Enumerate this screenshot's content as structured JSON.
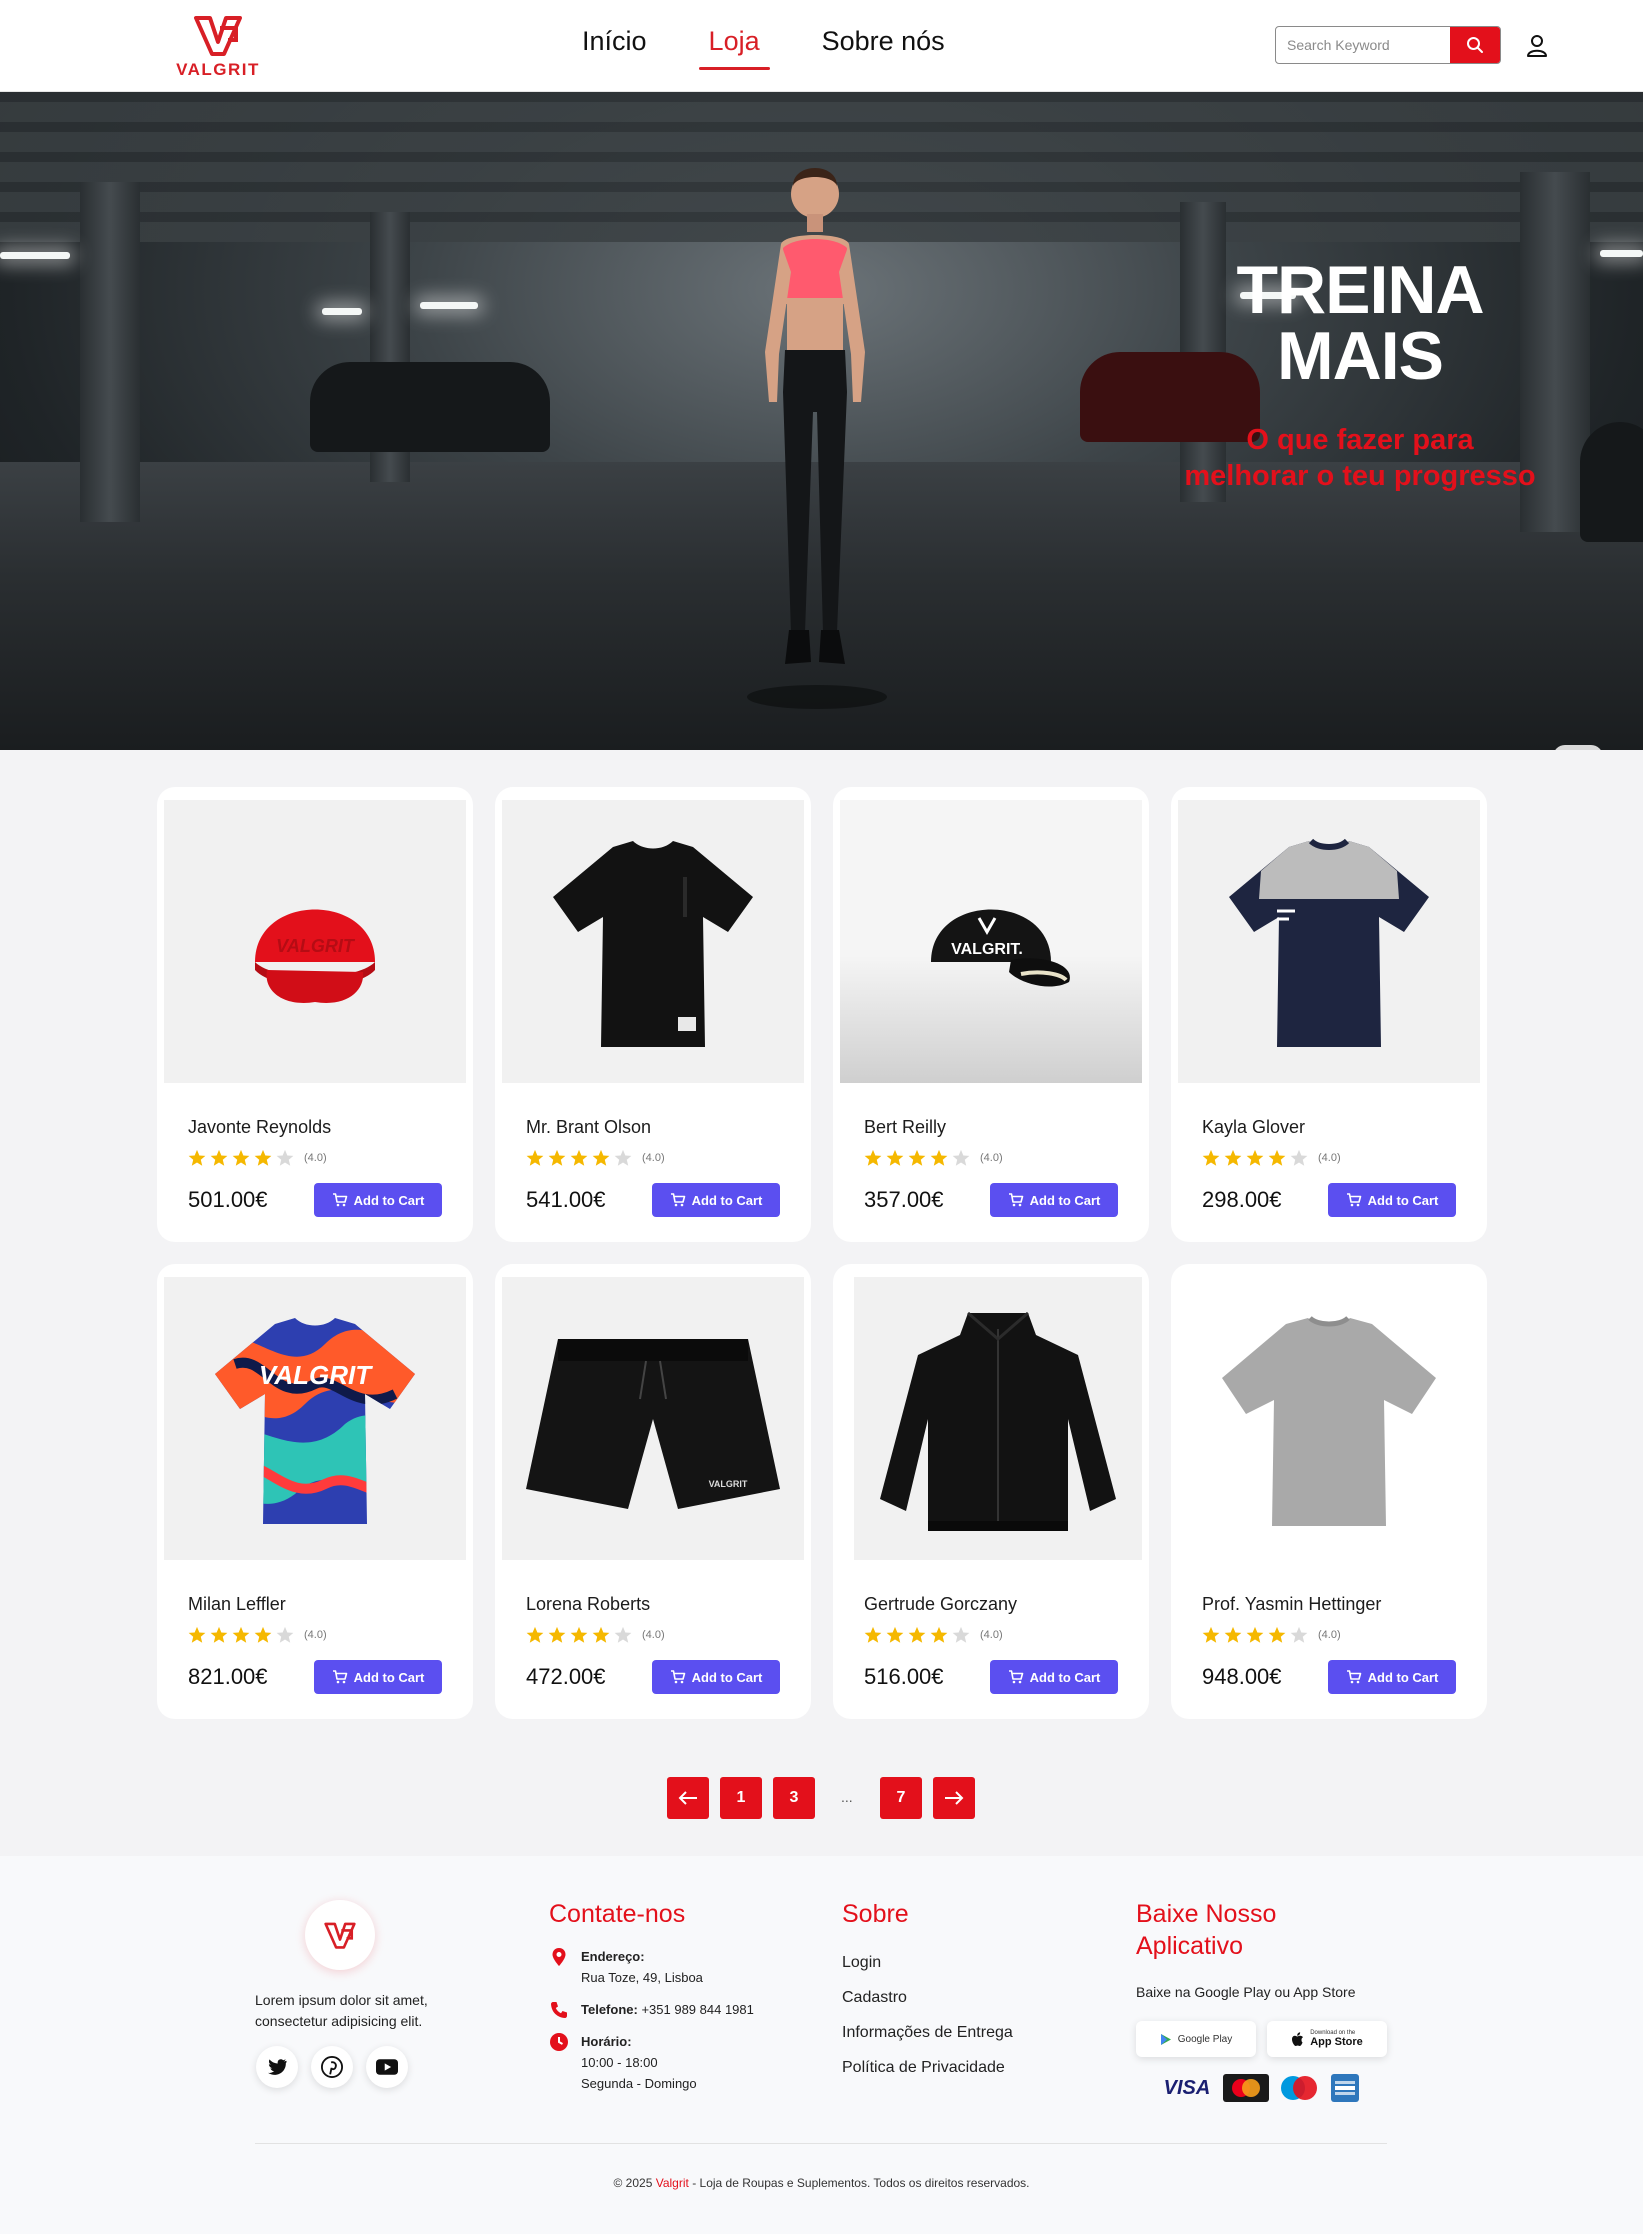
{
  "header": {
    "logo_text": "VALGRIT",
    "nav": [
      {
        "label": "Início",
        "active": false
      },
      {
        "label": "Loja",
        "active": true
      },
      {
        "label": "Sobre nós",
        "active": false
      }
    ],
    "search": {
      "placeholder": "Search Keyword",
      "value": ""
    },
    "icons": {
      "search": "search-icon",
      "user": "user-icon"
    }
  },
  "hero": {
    "title_line1": "TREINA",
    "title_line2": "MAIS",
    "subtitle_line1": "O que fazer para",
    "subtitle_line2": "melhorar o teu progresso"
  },
  "products": [
    {
      "name": "Javonte Reynolds",
      "rating": "(4.0)",
      "stars": 4,
      "price": "501.00€",
      "cta": "Add to Cart",
      "image": "red-cap"
    },
    {
      "name": "Mr. Brant Olson",
      "rating": "(4.0)",
      "stars": 4,
      "price": "541.00€",
      "cta": "Add to Cart",
      "image": "black-tshirt"
    },
    {
      "name": "Bert Reilly",
      "rating": "(4.0)",
      "stars": 4,
      "price": "357.00€",
      "cta": "Add to Cart",
      "image": "black-cap"
    },
    {
      "name": "Kayla Glover",
      "rating": "(4.0)",
      "stars": 4,
      "price": "298.00€",
      "cta": "Add to Cart",
      "image": "navy-grey-tshirt"
    },
    {
      "name": "Milan Leffler",
      "rating": "(4.0)",
      "stars": 4,
      "price": "821.00€",
      "cta": "Add to Cart",
      "image": "camo-tshirt"
    },
    {
      "name": "Lorena Roberts",
      "rating": "(4.0)",
      "stars": 4,
      "price": "472.00€",
      "cta": "Add to Cart",
      "image": "black-shorts"
    },
    {
      "name": "Gertrude Gorczany",
      "rating": "(4.0)",
      "stars": 4,
      "price": "516.00€",
      "cta": "Add to Cart",
      "image": "black-jacket"
    },
    {
      "name": "Prof. Yasmin Hettinger",
      "rating": "(4.0)",
      "stars": 4,
      "price": "948.00€",
      "cta": "Add to Cart",
      "image": "grey-tshirt"
    }
  ],
  "pagination": {
    "prev": "arrow-left-icon",
    "pages": [
      "1",
      "3"
    ],
    "ellipsis": "...",
    "last": "7",
    "next": "arrow-right-icon"
  },
  "footer": {
    "about_text_line1": "Lorem ipsum dolor sit amet,",
    "about_text_line2": "consectetur adipisicing elit.",
    "social": [
      "twitter-icon",
      "pinterest-icon",
      "youtube-icon"
    ],
    "contact": {
      "heading": "Contate-nos",
      "address_label": "Endereço:",
      "address_value": "Rua Toze, 49, Lisboa",
      "phone_label": "Telefone:",
      "phone_value": "+351 989 844 1981",
      "hours_label": "Horário:",
      "hours_value": "10:00 - 18:00",
      "days_value": "Segunda - Domingo"
    },
    "about": {
      "heading": "Sobre",
      "links": [
        "Login",
        "Cadastro",
        "Informações de Entrega",
        "Política de Privacidade"
      ]
    },
    "app": {
      "heading_line1": "Baixe Nosso",
      "heading_line2": "Aplicativo",
      "text": "Baixe na Google Play ou App Store",
      "google_play": "Google Play",
      "app_store_small": "Download on the",
      "app_store": "App Store",
      "payments": [
        "VISA",
        "MasterCard",
        "Maestro",
        "American Express"
      ]
    },
    "copyright_prefix": "© 2025",
    "copyright_brand": "Valgrit",
    "copyright_suffix": "- Loja de Roupas e Suplementos. Todos os direitos reservados."
  },
  "colors": {
    "brand_red": "#e3101b",
    "cta_purple": "#5b4ff0",
    "star_gold": "#f5b800"
  }
}
